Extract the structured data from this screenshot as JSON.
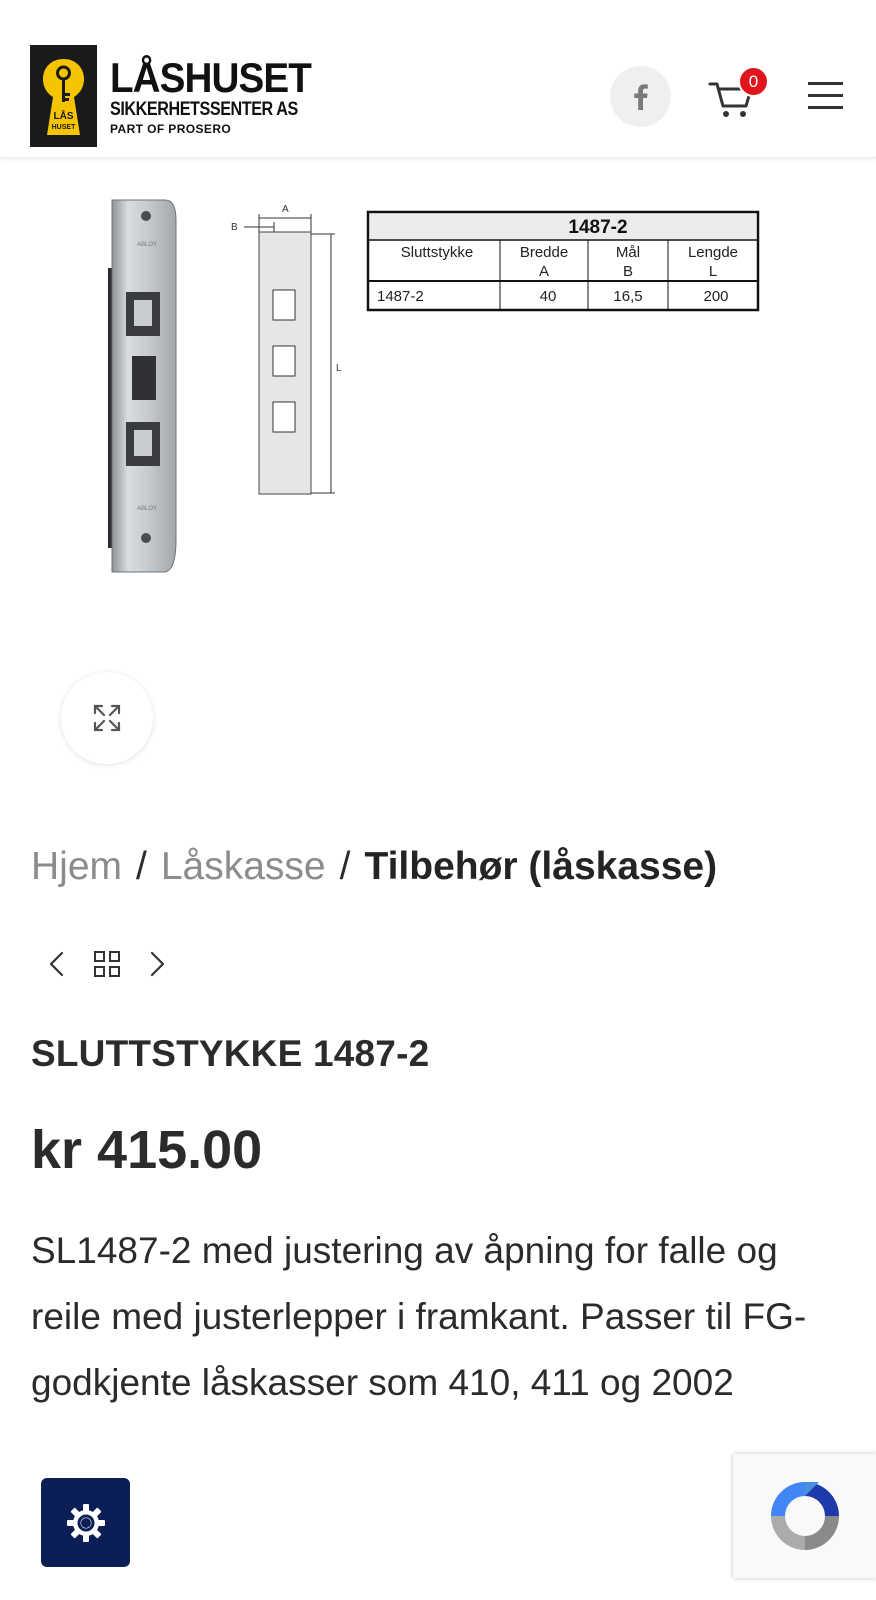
{
  "header": {
    "logo_title": "LÅSHUSET",
    "logo_subtitle": "SIKKERHETSSENTER AS",
    "logo_tagline": "PART OF PROSERO",
    "logo_badge": "LÅS HUSET",
    "cart_count": "0"
  },
  "diagram": {
    "table_title": "1487-2",
    "headers": [
      {
        "line1": "Sluttstykke",
        "line2": ""
      },
      {
        "line1": "Bredde",
        "line2": "A"
      },
      {
        "line1": "Mål",
        "line2": "B"
      },
      {
        "line1": "Lengde",
        "line2": "L"
      }
    ],
    "row": [
      "1487-2",
      "40",
      "16,5",
      "200"
    ],
    "dim_a": "A",
    "dim_b": "B",
    "dim_l": "L"
  },
  "breadcrumb": {
    "home": "Hjem",
    "category": "Låskasse",
    "current": "Tilbehør (låskasse)",
    "separator": "/"
  },
  "product": {
    "title": "SLUTTSTYKKE 1487-2",
    "price": "kr 415.00",
    "description": "SL1487-2 med justering av åpning for falle og reile med justerlepper i framkant. Passer til FG-godkjente låskasser som 410, 411 og 2002"
  },
  "colors": {
    "logo_yellow": "#f5c400",
    "badge_red": "#e2151f",
    "settings_blue": "#0b1e56"
  }
}
